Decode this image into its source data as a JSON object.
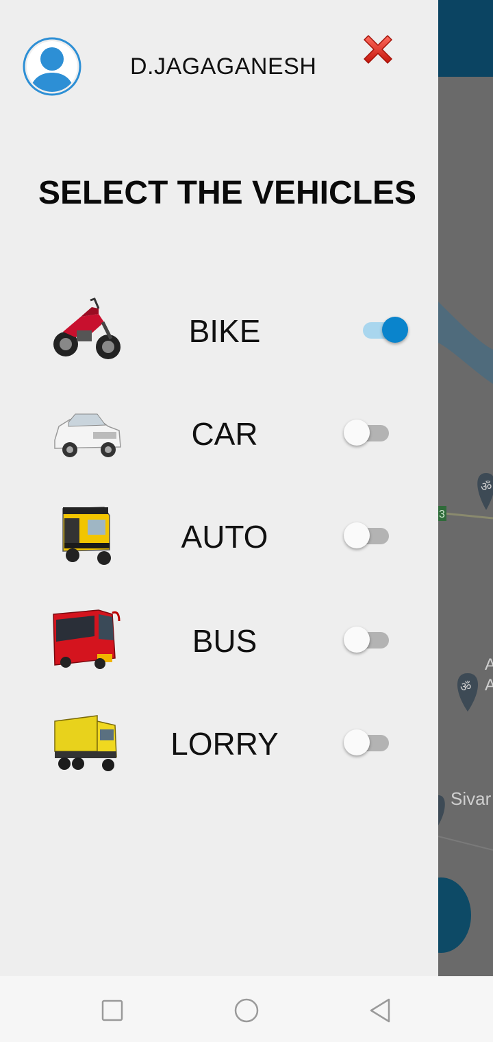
{
  "drawer": {
    "user_name": "D.JAGAGANESH",
    "title": "SELECT THE VEHICLES",
    "avatar_icon": "user-avatar-icon",
    "close_icon": "close-icon",
    "vehicles": [
      {
        "label": "BIKE",
        "icon": "bike-icon",
        "enabled": true
      },
      {
        "label": "CAR",
        "icon": "car-icon",
        "enabled": false
      },
      {
        "label": "AUTO",
        "icon": "auto-rickshaw-icon",
        "enabled": false
      },
      {
        "label": "BUS",
        "icon": "bus-icon",
        "enabled": false
      },
      {
        "label": "LORRY",
        "icon": "lorry-icon",
        "enabled": false
      }
    ]
  },
  "map": {
    "place_label": "Sivar",
    "label_a1": "A",
    "label_a2": "A",
    "route_badge": "3"
  },
  "colors": {
    "toggle_on": "#0a84cc",
    "toggle_on_track": "#a9d6ee",
    "toggle_off_track": "#b3b3b3",
    "close_red": "#e53935",
    "avatar_blue": "#2d8fd5",
    "appbar": "#0b4462"
  },
  "navbar": {
    "recent_icon": "recent-apps-icon",
    "home_icon": "home-icon",
    "back_icon": "back-icon"
  }
}
